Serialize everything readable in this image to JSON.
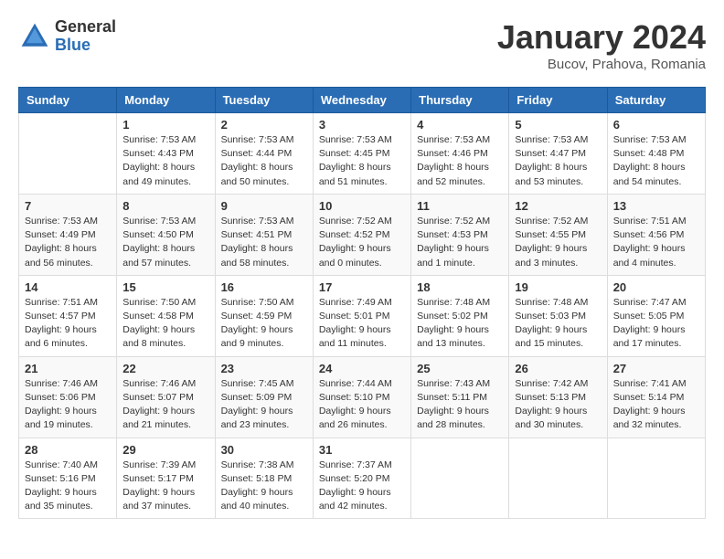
{
  "header": {
    "logo_general": "General",
    "logo_blue": "Blue",
    "title": "January 2024",
    "location": "Bucov, Prahova, Romania"
  },
  "days_of_week": [
    "Sunday",
    "Monday",
    "Tuesday",
    "Wednesday",
    "Thursday",
    "Friday",
    "Saturday"
  ],
  "weeks": [
    [
      {
        "day": "",
        "info": ""
      },
      {
        "day": "1",
        "info": "Sunrise: 7:53 AM\nSunset: 4:43 PM\nDaylight: 8 hours\nand 49 minutes."
      },
      {
        "day": "2",
        "info": "Sunrise: 7:53 AM\nSunset: 4:44 PM\nDaylight: 8 hours\nand 50 minutes."
      },
      {
        "day": "3",
        "info": "Sunrise: 7:53 AM\nSunset: 4:45 PM\nDaylight: 8 hours\nand 51 minutes."
      },
      {
        "day": "4",
        "info": "Sunrise: 7:53 AM\nSunset: 4:46 PM\nDaylight: 8 hours\nand 52 minutes."
      },
      {
        "day": "5",
        "info": "Sunrise: 7:53 AM\nSunset: 4:47 PM\nDaylight: 8 hours\nand 53 minutes."
      },
      {
        "day": "6",
        "info": "Sunrise: 7:53 AM\nSunset: 4:48 PM\nDaylight: 8 hours\nand 54 minutes."
      }
    ],
    [
      {
        "day": "7",
        "info": "Sunrise: 7:53 AM\nSunset: 4:49 PM\nDaylight: 8 hours\nand 56 minutes."
      },
      {
        "day": "8",
        "info": "Sunrise: 7:53 AM\nSunset: 4:50 PM\nDaylight: 8 hours\nand 57 minutes."
      },
      {
        "day": "9",
        "info": "Sunrise: 7:53 AM\nSunset: 4:51 PM\nDaylight: 8 hours\nand 58 minutes."
      },
      {
        "day": "10",
        "info": "Sunrise: 7:52 AM\nSunset: 4:52 PM\nDaylight: 9 hours\nand 0 minutes."
      },
      {
        "day": "11",
        "info": "Sunrise: 7:52 AM\nSunset: 4:53 PM\nDaylight: 9 hours\nand 1 minute."
      },
      {
        "day": "12",
        "info": "Sunrise: 7:52 AM\nSunset: 4:55 PM\nDaylight: 9 hours\nand 3 minutes."
      },
      {
        "day": "13",
        "info": "Sunrise: 7:51 AM\nSunset: 4:56 PM\nDaylight: 9 hours\nand 4 minutes."
      }
    ],
    [
      {
        "day": "14",
        "info": "Sunrise: 7:51 AM\nSunset: 4:57 PM\nDaylight: 9 hours\nand 6 minutes."
      },
      {
        "day": "15",
        "info": "Sunrise: 7:50 AM\nSunset: 4:58 PM\nDaylight: 9 hours\nand 8 minutes."
      },
      {
        "day": "16",
        "info": "Sunrise: 7:50 AM\nSunset: 4:59 PM\nDaylight: 9 hours\nand 9 minutes."
      },
      {
        "day": "17",
        "info": "Sunrise: 7:49 AM\nSunset: 5:01 PM\nDaylight: 9 hours\nand 11 minutes."
      },
      {
        "day": "18",
        "info": "Sunrise: 7:48 AM\nSunset: 5:02 PM\nDaylight: 9 hours\nand 13 minutes."
      },
      {
        "day": "19",
        "info": "Sunrise: 7:48 AM\nSunset: 5:03 PM\nDaylight: 9 hours\nand 15 minutes."
      },
      {
        "day": "20",
        "info": "Sunrise: 7:47 AM\nSunset: 5:05 PM\nDaylight: 9 hours\nand 17 minutes."
      }
    ],
    [
      {
        "day": "21",
        "info": "Sunrise: 7:46 AM\nSunset: 5:06 PM\nDaylight: 9 hours\nand 19 minutes."
      },
      {
        "day": "22",
        "info": "Sunrise: 7:46 AM\nSunset: 5:07 PM\nDaylight: 9 hours\nand 21 minutes."
      },
      {
        "day": "23",
        "info": "Sunrise: 7:45 AM\nSunset: 5:09 PM\nDaylight: 9 hours\nand 23 minutes."
      },
      {
        "day": "24",
        "info": "Sunrise: 7:44 AM\nSunset: 5:10 PM\nDaylight: 9 hours\nand 26 minutes."
      },
      {
        "day": "25",
        "info": "Sunrise: 7:43 AM\nSunset: 5:11 PM\nDaylight: 9 hours\nand 28 minutes."
      },
      {
        "day": "26",
        "info": "Sunrise: 7:42 AM\nSunset: 5:13 PM\nDaylight: 9 hours\nand 30 minutes."
      },
      {
        "day": "27",
        "info": "Sunrise: 7:41 AM\nSunset: 5:14 PM\nDaylight: 9 hours\nand 32 minutes."
      }
    ],
    [
      {
        "day": "28",
        "info": "Sunrise: 7:40 AM\nSunset: 5:16 PM\nDaylight: 9 hours\nand 35 minutes."
      },
      {
        "day": "29",
        "info": "Sunrise: 7:39 AM\nSunset: 5:17 PM\nDaylight: 9 hours\nand 37 minutes."
      },
      {
        "day": "30",
        "info": "Sunrise: 7:38 AM\nSunset: 5:18 PM\nDaylight: 9 hours\nand 40 minutes."
      },
      {
        "day": "31",
        "info": "Sunrise: 7:37 AM\nSunset: 5:20 PM\nDaylight: 9 hours\nand 42 minutes."
      },
      {
        "day": "",
        "info": ""
      },
      {
        "day": "",
        "info": ""
      },
      {
        "day": "",
        "info": ""
      }
    ]
  ]
}
